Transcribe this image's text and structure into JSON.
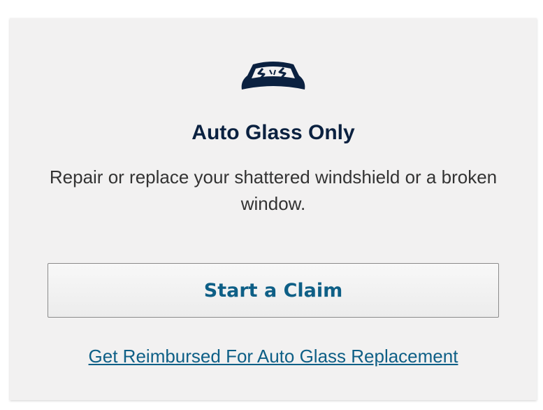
{
  "card": {
    "icon": "broken-windshield-icon",
    "title": "Auto Glass Only",
    "description": "Repair or replace your shattered windshield or a broken window.",
    "primary_button_label": "Start a Claim",
    "secondary_link_label": "Get Reimbursed For Auto Glass Replacement"
  },
  "colors": {
    "card_background": "#f2f1f1",
    "title": "#0b2140",
    "accent": "#0e5f86",
    "icon": "#0b2140"
  }
}
